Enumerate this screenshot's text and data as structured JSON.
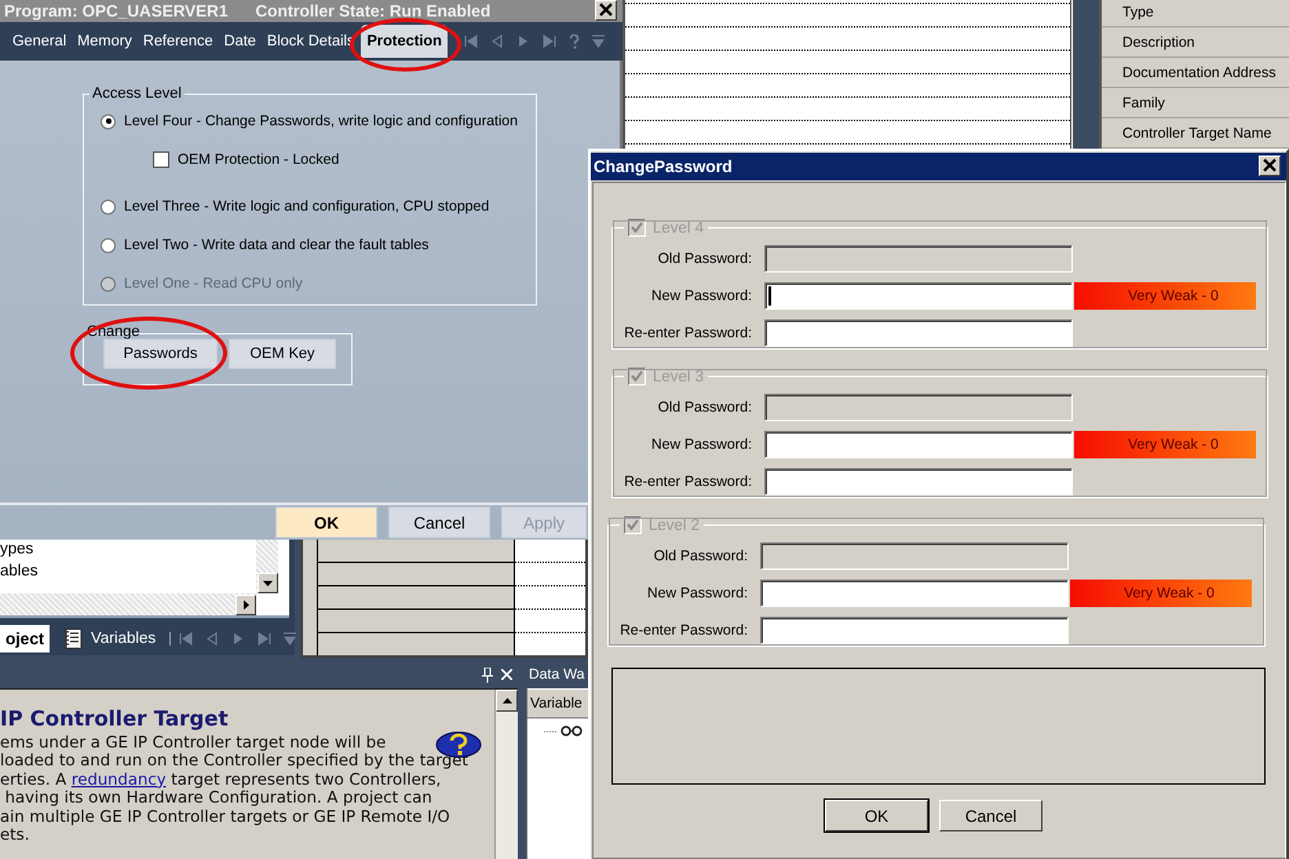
{
  "properties_dialog": {
    "title": "Program: OPC_UASERVER1",
    "controller_state": "Controller State: Run Enabled",
    "tabs": [
      {
        "label": "General",
        "selected": false,
        "circled": false
      },
      {
        "label": "Memory",
        "selected": false,
        "circled": false
      },
      {
        "label": "Reference",
        "selected": false,
        "circled": false
      },
      {
        "label": "Date",
        "selected": false,
        "circled": false
      },
      {
        "label": "Block Details",
        "selected": false,
        "circled": false
      },
      {
        "label": "Protection",
        "selected": true,
        "circled": true
      }
    ],
    "access_level": {
      "title": "Access Level",
      "options": [
        {
          "label": "Level Four - Change Passwords, write logic and configuration",
          "selected": true,
          "disabled": false,
          "sub_option": {
            "label": "OEM Protection - Locked",
            "checked": false
          }
        },
        {
          "label": "Level Three - Write logic and configuration, CPU stopped",
          "selected": false,
          "disabled": false
        },
        {
          "label": "Level Two - Write data and clear the fault tables",
          "selected": false,
          "disabled": false
        },
        {
          "label": "Level One - Read CPU only",
          "selected": false,
          "disabled": true
        }
      ]
    },
    "change": {
      "title": "Change",
      "buttons": [
        {
          "label": "Passwords",
          "circled": true
        },
        {
          "label": "OEM Key",
          "circled": false
        }
      ]
    },
    "buttons": [
      {
        "label": "OK",
        "kind": "default",
        "disabled": false
      },
      {
        "label": "Cancel",
        "kind": "normal",
        "disabled": false
      },
      {
        "label": "Apply",
        "kind": "normal",
        "disabled": true
      }
    ]
  },
  "properties_list": [
    "Type",
    "Description",
    "Documentation Address",
    "Family",
    "Controller Target Name"
  ],
  "project_pane": {
    "tree_items": [
      "ypes",
      "ables"
    ],
    "tabs": [
      {
        "label": "oject",
        "selected": true
      },
      {
        "label": "Variables",
        "selected": false
      }
    ]
  },
  "companion": {
    "heading": "IP Controller Target",
    "lines": [
      [
        {
          "kind": "text",
          "text": "ems under a GE IP Controller target node will be"
        }
      ],
      [
        {
          "kind": "text",
          "text": "loaded to and run on the Controller specified by the target"
        }
      ],
      [
        {
          "kind": "text",
          "text": "erties. A "
        },
        {
          "kind": "link",
          "text": "redundancy"
        },
        {
          "kind": "text",
          "text": " target represents two Controllers,"
        }
      ],
      [
        {
          "kind": "text",
          "text": " having its own Hardware Configuration. A project can"
        }
      ],
      [
        {
          "kind": "text",
          "text": "ain multiple GE IP Controller targets or GE IP Remote I/O"
        }
      ],
      [
        {
          "kind": "text",
          "text": "ets."
        }
      ]
    ]
  },
  "data_watch": {
    "title": "Data Wa",
    "columns": [
      "Variable"
    ]
  },
  "change_password": {
    "title": "ChangePassword",
    "groups": [
      {
        "label": "Level 4",
        "checked": true,
        "disabled": true,
        "fields": [
          {
            "label": "Old Password:",
            "disabled": true,
            "focused": false
          },
          {
            "label": "New Password:",
            "disabled": false,
            "focused": true,
            "strength": "Very Weak - 0"
          },
          {
            "label": "Re-enter Password:",
            "disabled": false,
            "focused": false
          }
        ]
      },
      {
        "label": "Level 3",
        "checked": true,
        "disabled": true,
        "fields": [
          {
            "label": "Old Password:",
            "disabled": true,
            "focused": false
          },
          {
            "label": "New Password:",
            "disabled": false,
            "focused": false,
            "strength": "Very Weak - 0"
          },
          {
            "label": "Re-enter Password:",
            "disabled": false,
            "focused": false
          }
        ]
      },
      {
        "label": "Level 2",
        "checked": true,
        "disabled": true,
        "fields": [
          {
            "label": "Old Password:",
            "disabled": true,
            "focused": false
          },
          {
            "label": "New Password:",
            "disabled": false,
            "focused": false,
            "strength": "Very Weak - 0"
          },
          {
            "label": "Re-enter Password:",
            "disabled": false,
            "focused": false
          }
        ]
      }
    ],
    "buttons": [
      {
        "label": "OK",
        "kind": "default"
      },
      {
        "label": "Cancel",
        "kind": "normal"
      }
    ]
  }
}
